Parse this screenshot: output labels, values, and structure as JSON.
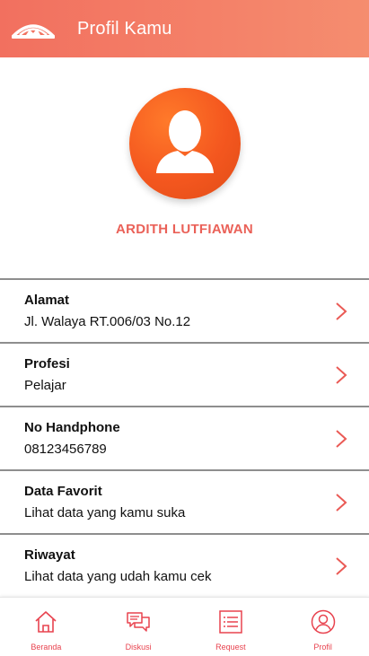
{
  "header": {
    "title": "Profil Kamu",
    "logo_icon": "house-roof-logo-icon",
    "color_start": "#f2705f",
    "color_end": "#f58d6f"
  },
  "profile": {
    "avatar_icon": "user-silhouette-icon",
    "name": "ARDITH LUTFIAWAN",
    "name_color": "#ea6158",
    "avatar_color": "#f4571f"
  },
  "items": [
    {
      "label": "Alamat",
      "value": "Jl. Walaya RT.006/03 No.12"
    },
    {
      "label": "Profesi",
      "value": "Pelajar"
    },
    {
      "label": "No Handphone",
      "value": "08123456789"
    },
    {
      "label": "Data Favorit",
      "value": "Lihat data yang kamu suka"
    },
    {
      "label": "Riwayat",
      "value": "Lihat data yang udah kamu cek"
    }
  ],
  "nav": [
    {
      "label": "Beranda",
      "icon": "home-icon"
    },
    {
      "label": "Diskusi",
      "icon": "chat-icon"
    },
    {
      "label": "Request",
      "icon": "list-icon"
    },
    {
      "label": "Profil",
      "icon": "profile-icon"
    }
  ],
  "accent": "#e8434f"
}
